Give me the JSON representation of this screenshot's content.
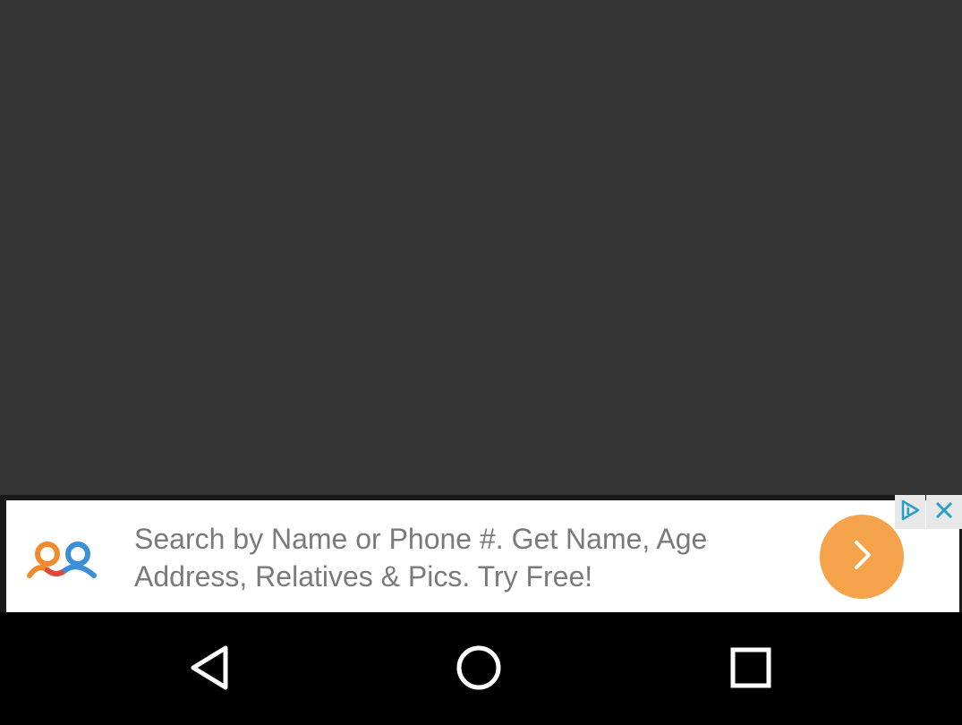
{
  "ad": {
    "text": "Search by Name or Phone #. Get Name, Age\nAddress, Relatives & Pics. Try Free!",
    "logo_icon": "people-search-logo",
    "cta_icon": "chevron-right-icon",
    "adchoices_icon": "adchoices-icon",
    "close_icon": "close-icon",
    "colors": {
      "cta": "#f5a34a",
      "text": "#7a7a7a",
      "adchoices": "#2aa0c8",
      "logo_orange": "#f08a2c",
      "logo_blue": "#3a8fd6"
    }
  },
  "app": {
    "background": "#333333"
  },
  "navigation": {
    "back_icon": "back-triangle-icon",
    "home_icon": "home-circle-icon",
    "recents_icon": "recents-square-icon"
  }
}
